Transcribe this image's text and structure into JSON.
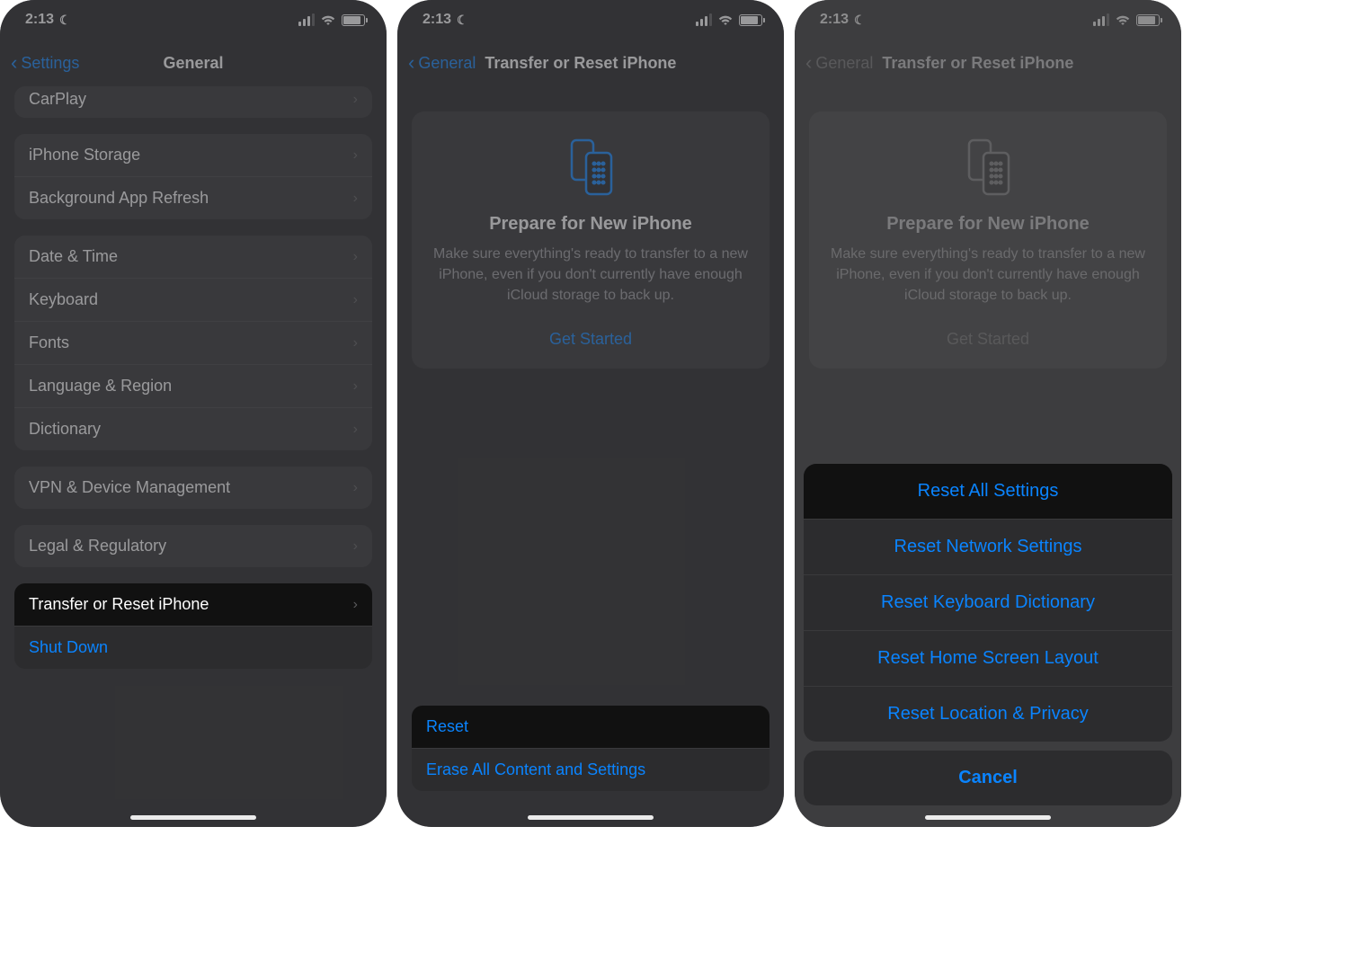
{
  "status": {
    "time": "2:13"
  },
  "screen1": {
    "back": "Settings",
    "title": "General",
    "rows": {
      "carplay": "CarPlay",
      "storage": "iPhone Storage",
      "bg_refresh": "Background App Refresh",
      "date_time": "Date & Time",
      "keyboard": "Keyboard",
      "fonts": "Fonts",
      "lang_region": "Language & Region",
      "dictionary": "Dictionary",
      "vpn": "VPN & Device Management",
      "legal": "Legal & Regulatory",
      "transfer_reset": "Transfer or Reset iPhone",
      "shutdown": "Shut Down"
    }
  },
  "screen2": {
    "back": "General",
    "title": "Transfer or Reset iPhone",
    "card": {
      "title": "Prepare for New iPhone",
      "desc": "Make sure everything's ready to transfer to a new iPhone, even if you don't currently have enough iCloud storage to back up.",
      "cta": "Get Started"
    },
    "reset": "Reset",
    "erase": "Erase All Content and Settings"
  },
  "screen3": {
    "back": "General",
    "title": "Transfer or Reset iPhone",
    "card": {
      "title": "Prepare for New iPhone",
      "desc": "Make sure everything's ready to transfer to a new iPhone, even if you don't currently have enough iCloud storage to back up.",
      "cta": "Get Started"
    },
    "sheet": {
      "reset_all": "Reset All Settings",
      "reset_network": "Reset Network Settings",
      "reset_keyboard": "Reset Keyboard Dictionary",
      "reset_home": "Reset Home Screen Layout",
      "reset_location": "Reset Location & Privacy",
      "cancel": "Cancel"
    }
  }
}
